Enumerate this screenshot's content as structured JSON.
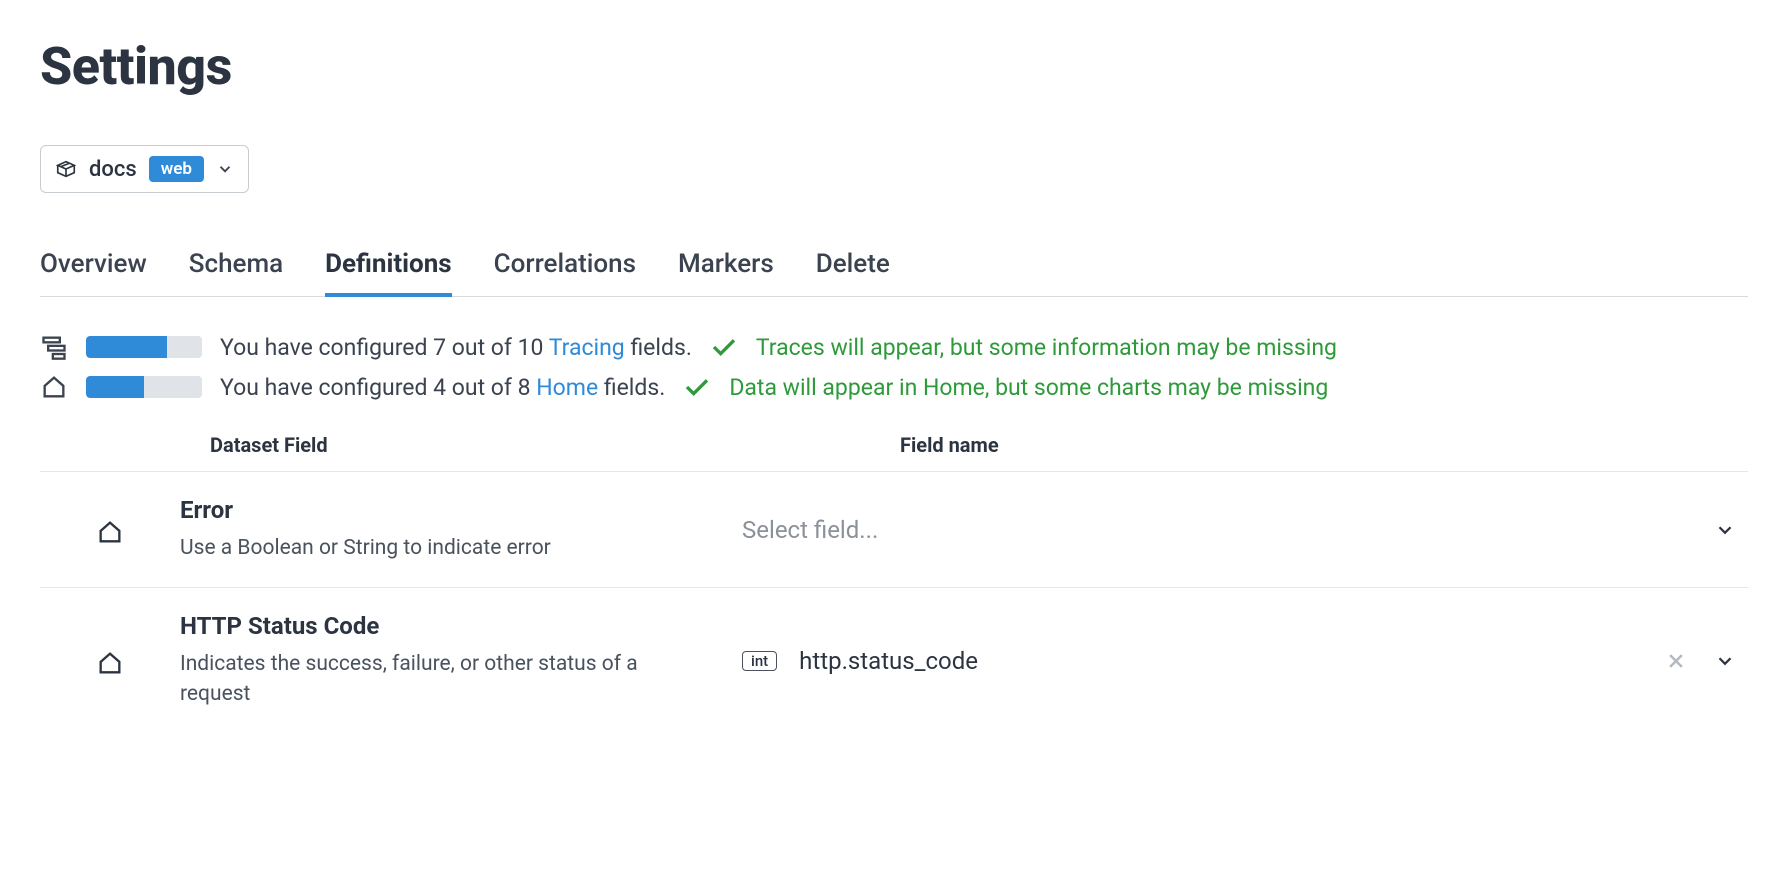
{
  "page": {
    "title": "Settings"
  },
  "dataset": {
    "name": "docs",
    "badge": "web"
  },
  "tabs": {
    "items": [
      {
        "label": "Overview"
      },
      {
        "label": "Schema"
      },
      {
        "label": "Definitions"
      },
      {
        "label": "Correlations"
      },
      {
        "label": "Markers"
      },
      {
        "label": "Delete"
      }
    ],
    "active_index": 2
  },
  "status": {
    "tracing": {
      "prefix": "You have configured 7 out of 10 ",
      "link": "Tracing",
      "suffix": " fields.",
      "ok_text": "Traces will appear, but some information may be missing",
      "progress_pct": 70
    },
    "home": {
      "prefix": "You have configured 4 out of 8 ",
      "link": "Home",
      "suffix": " fields.",
      "ok_text": "Data will appear in Home, but some charts may be missing",
      "progress_pct": 50
    }
  },
  "table": {
    "headers": {
      "field": "Dataset Field",
      "name": "Field name"
    },
    "rows": [
      {
        "title": "Error",
        "desc": "Use a Boolean or String to indicate error",
        "placeholder": "Select field...",
        "value": "",
        "type_badge": ""
      },
      {
        "title": "HTTP Status Code",
        "desc": "Indicates the success, failure, or other status of a request",
        "placeholder": "",
        "value": "http.status_code",
        "type_badge": "int"
      }
    ]
  }
}
